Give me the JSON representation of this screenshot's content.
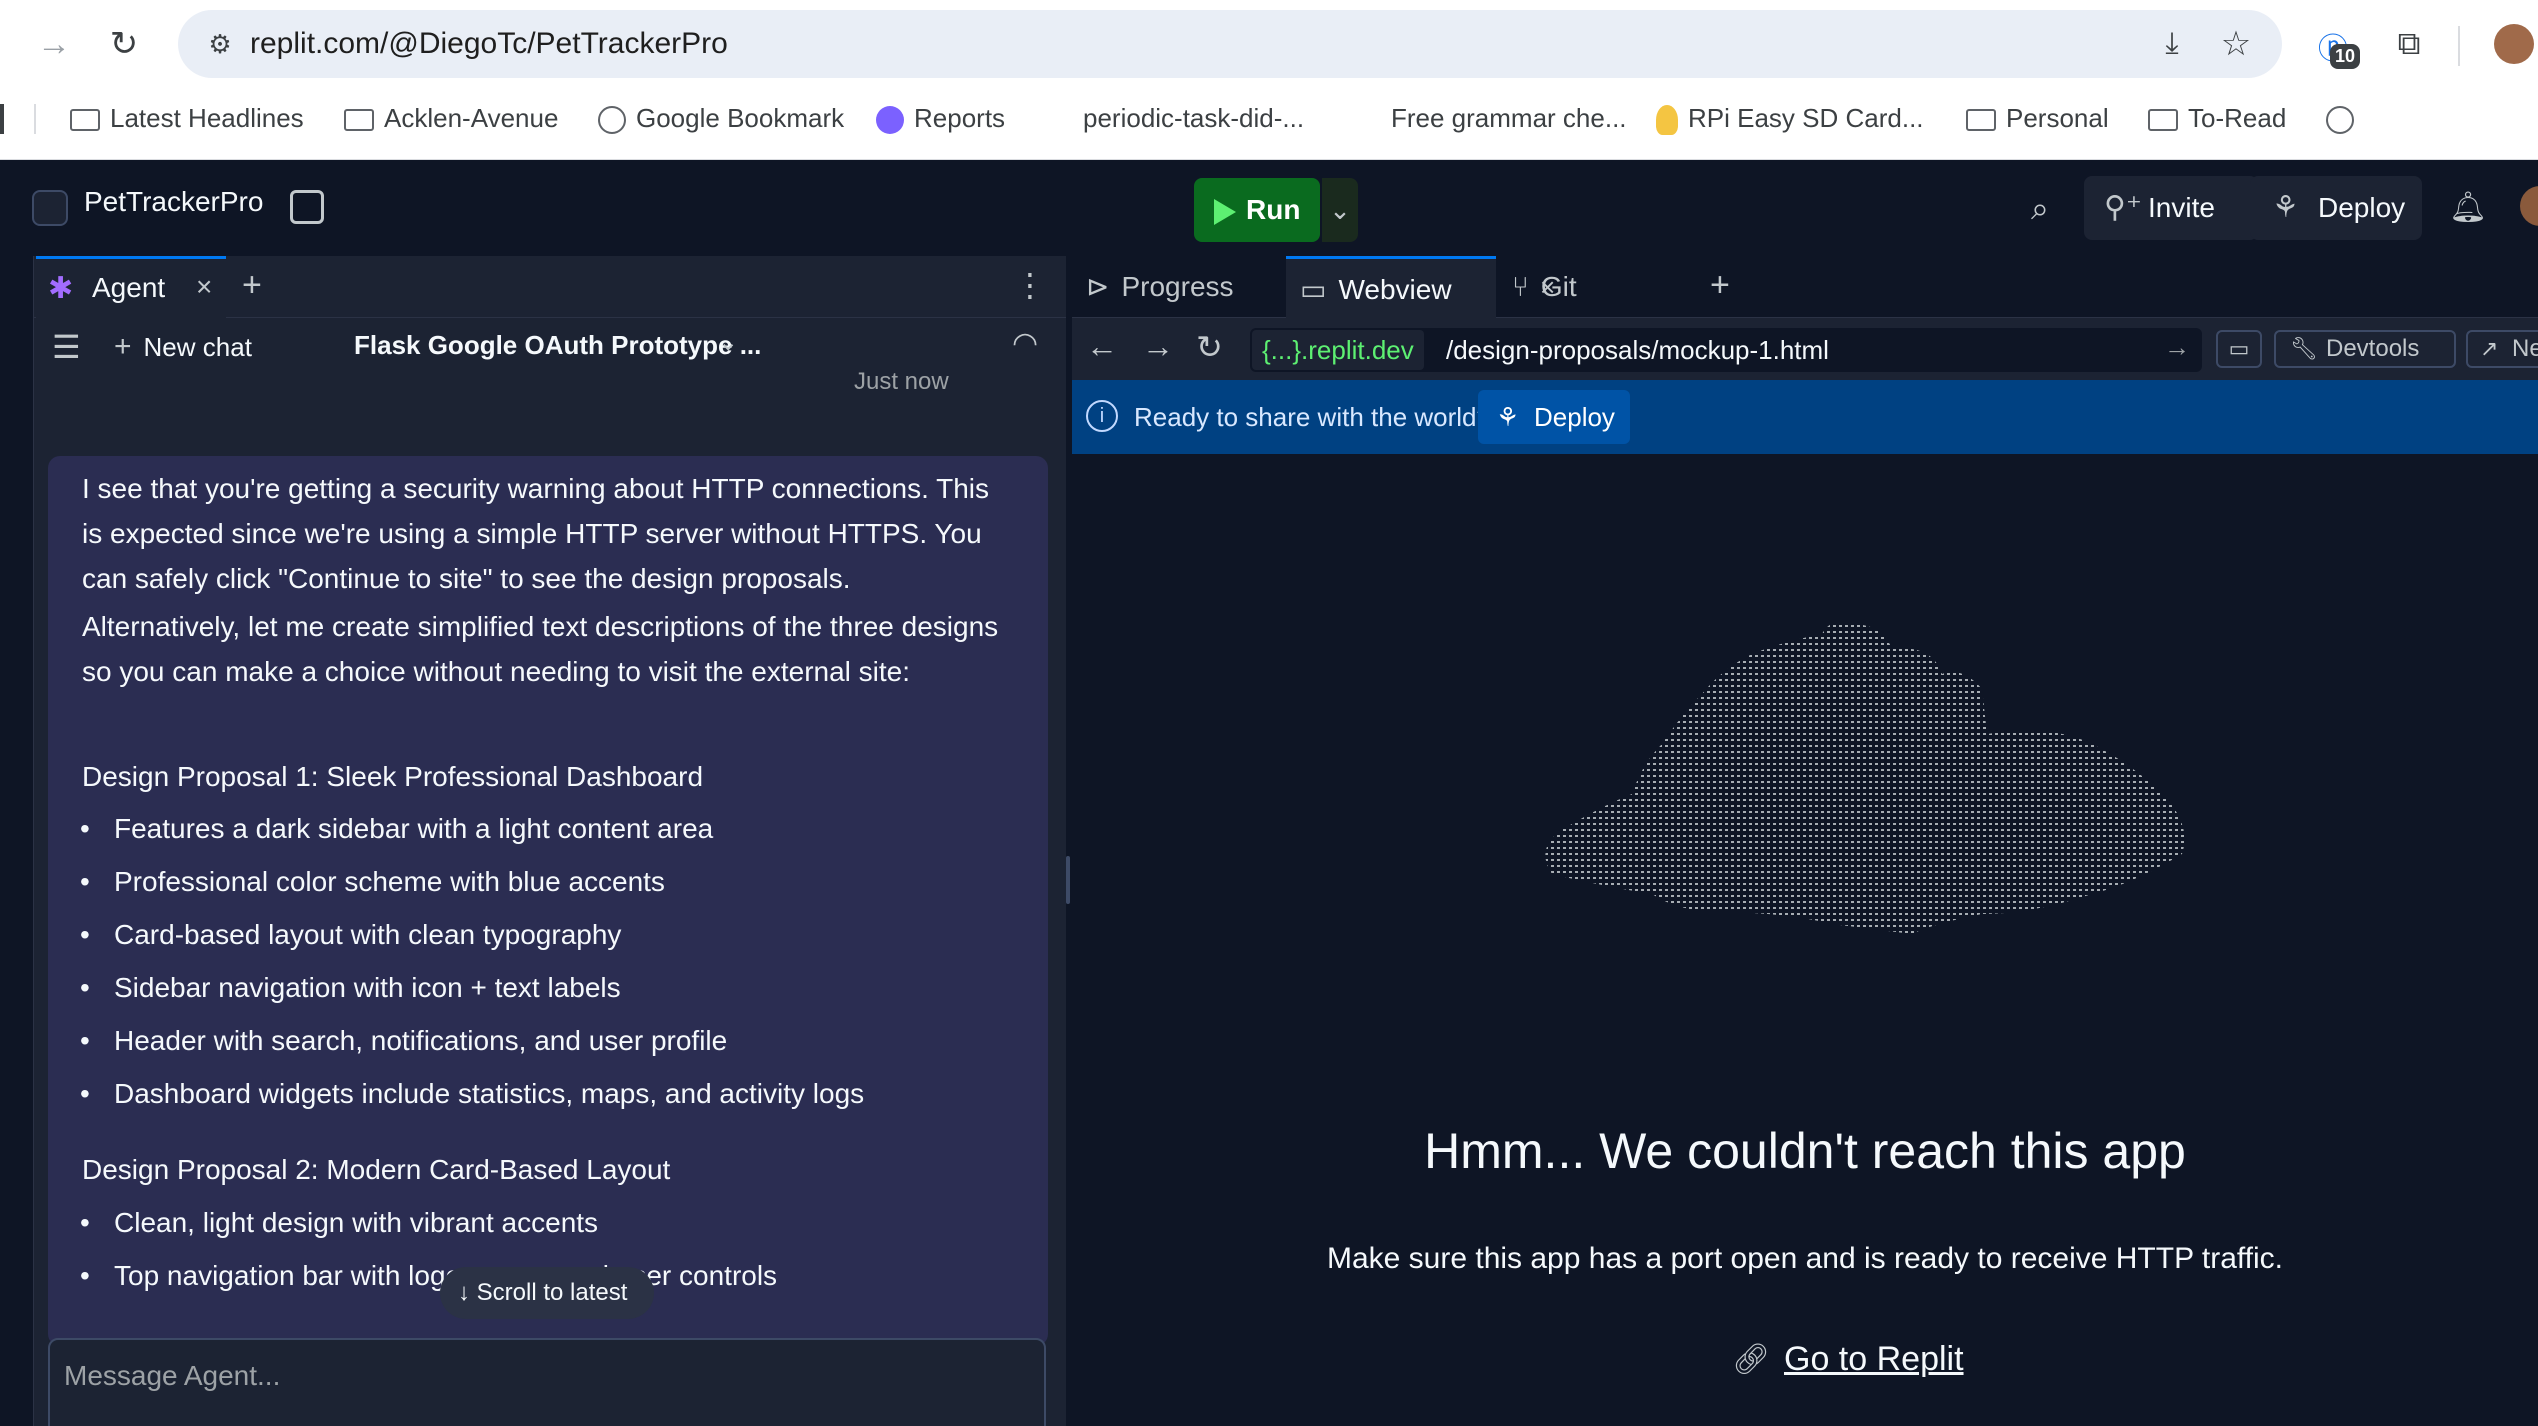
{
  "browser": {
    "url": "replit.com/@DiegoTc/PetTrackerPro",
    "extension_badge": "10",
    "bookmarks": [
      {
        "label": "Latest Headlines",
        "icon": "folder-icon"
      },
      {
        "label": "Acklen-Avenue",
        "icon": "folder-icon"
      },
      {
        "label": "Google Bookmark",
        "icon": "globe-icon"
      },
      {
        "label": "Reports",
        "icon": "reports-icon"
      },
      {
        "label": "periodic-task-did-...",
        "icon": ""
      },
      {
        "label": "Free grammar che...",
        "icon": ""
      },
      {
        "label": "RPi Easy SD Card...",
        "icon": "linux-icon"
      },
      {
        "label": "Personal",
        "icon": "folder-icon"
      },
      {
        "label": "To-Read",
        "icon": "folder-icon"
      }
    ]
  },
  "header": {
    "repl_name": "PetTrackerPro",
    "run_label": "Run",
    "invite_label": "Invite",
    "deploy_label": "Deploy"
  },
  "agent": {
    "tab_label": "Agent",
    "new_chat_label": "New chat",
    "chat_title": "Flask Google OAuth Prototype ...",
    "timestamp": "Just now",
    "message": {
      "para1": "I see that you're getting a security warning about HTTP connections. This is expected since we're using a simple HTTP server without HTTPS. You can safely click \"Continue to site\" to see the design proposals.",
      "para2": "Alternatively, let me create simplified text descriptions of the three designs so you can make a choice without needing to visit the external site:",
      "design1_heading": "Design Proposal 1: Sleek Professional Dashboard",
      "design1_items": [
        "Features a dark sidebar with a light content area",
        "Professional color scheme with blue accents",
        "Card-based layout with clean typography",
        "Sidebar navigation with icon + text labels",
        "Header with search, notifications, and user profile",
        "Dashboard widgets include statistics, maps, and activity logs"
      ],
      "design2_heading": "Design Proposal 2: Modern Card-Based Layout",
      "design2_items": [
        "Clean, light design with vibrant accents",
        "Top navigation bar with logo, menu, and user controls"
      ]
    },
    "scroll_latest_label": "Scroll to latest",
    "input_placeholder": "Message Agent..."
  },
  "right_tabs": [
    {
      "label": "Progress"
    },
    {
      "label": "Webview"
    },
    {
      "label": "Git"
    }
  ],
  "webview": {
    "domain_chip": "{...}.replit.dev",
    "path": "/design-proposals/mockup-1.html",
    "devtools_label": "Devtools",
    "new_tab_label": "New tab",
    "banner_text": "Ready to share with the world?",
    "banner_deploy_label": "Deploy",
    "error_heading": "Hmm... We couldn't reach this app",
    "error_subtext": "Make sure this app has a port open and is ready to receive HTTP traffic.",
    "go_to_replit_label": "Go to Replit"
  },
  "colors": {
    "run_green": "#0a6b1f",
    "agent_message_bg": "#2b2d52",
    "banner_blue": "#004182",
    "accent_blue": "#0079f2"
  }
}
